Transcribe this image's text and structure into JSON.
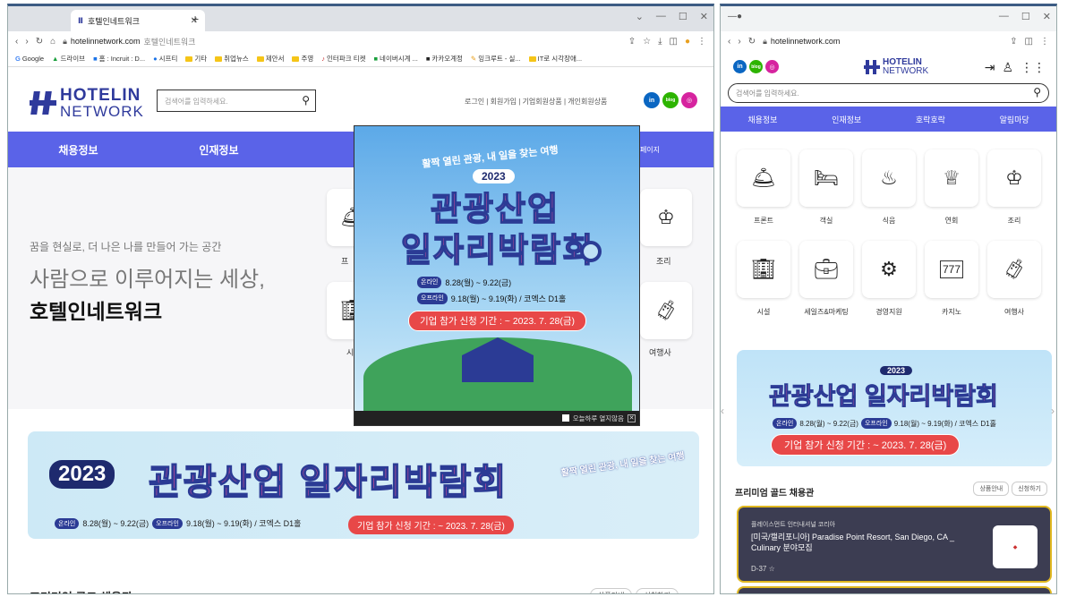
{
  "left_browser": {
    "tab_title": "호텔인네트워크",
    "url_domain": "hotelinnetwork.com",
    "url_suffix": "호텔인네트워크",
    "bookmarks": [
      "Google",
      "드라이브",
      "홈 : Incruit : D...",
      "시프티",
      "기타",
      "취업뉴스",
      "제안서",
      "주영",
      "인터파크 티켓",
      "네이버시계 ...",
      "카카오계정",
      "잉크루트 - 실...",
      "IT로 시각장애..."
    ]
  },
  "right_browser": {
    "url_domain": "hotelinnetwork.com"
  },
  "site": {
    "logo_top": "HOTELIN",
    "logo_bottom": "NETWORK",
    "search_placeholder": "검색어를 입력하세요.",
    "top_links": "로그인 | 회원가입 | 기업회원상품 | 개인회원상품",
    "sns": [
      "in",
      "blog",
      "ig"
    ],
    "nav": [
      "채용정보",
      "인재정보",
      "호",
      "",
      "페이지"
    ],
    "hero_line1": "꿈을 현실로, 더 나은 나를 만들어 가는 공간",
    "hero_line2": "사람으로 이루어지는 세상,",
    "hero_line3": "호텔인네트워크",
    "left_labels": [
      "프",
      "조리",
      "시",
      "여행사"
    ]
  },
  "banner": {
    "year": "2023",
    "title": "관광산업 일자리박람회",
    "tagline": "활짝 열린 관광, 내 일을 찾는 여행",
    "online_tag": "온라인",
    "online_dates": "8.28(월) ~ 9.22(금)",
    "offline_tag": "오프라인",
    "offline_dates": "9.18(월) ~ 9.19(화) / 코엑스 D1홀",
    "deadline": "기업 참가 신청 기간 : ~ 2023. 7. 28(금)"
  },
  "popup": {
    "tagline": "활짝 열린 관광, 내 일을 찾는 여행",
    "title1": "관광산업",
    "title2": "일자리박람회",
    "dont_show": "오늘하루 열지않음"
  },
  "premium": {
    "title": "프리미엄 골드 채용관",
    "btn1": "상품안내",
    "btn2": "신청하기"
  },
  "mobile": {
    "nav": [
      "채용정보",
      "인재정보",
      "호락호락",
      "알림마당"
    ],
    "categories": [
      "프론트",
      "객실",
      "식음",
      "연회",
      "조리",
      "시설",
      "세일즈&마케팅",
      "경영지원",
      "카지노",
      "여행사"
    ],
    "job": {
      "company": "플레이스먼트 인터내셔널 코리아",
      "title": "[미국/캘리포니아] Paradise Point Resort, San Diego, CA _ Culinary 분야모집",
      "dday": "D-37"
    }
  }
}
